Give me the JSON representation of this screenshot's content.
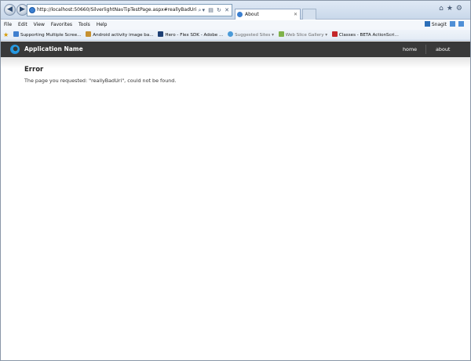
{
  "browser": {
    "address": "http://localhost:50660/SilverlightNavTipTestPage.aspx#reallyBadUri",
    "tab_title": "About",
    "menu": [
      "File",
      "Edit",
      "View",
      "Favorites",
      "Tools",
      "Help"
    ],
    "snagit_label": "Snagit",
    "favorites": [
      "Supporting Multiple Scree...",
      "Android activity image ba...",
      "Hero - Flex SDK - Adobe ...",
      "Suggested Sites",
      "Web Slice Gallery",
      "Classes - BETA ActionScri..."
    ]
  },
  "app": {
    "name": "Application Name",
    "nav": {
      "home": "home",
      "about": "about"
    }
  },
  "error": {
    "title": "Error",
    "message": "The page you requested: \"reallyBadUri\", could not be found."
  },
  "colors": {
    "header_bg": "#393939",
    "logo_accent": "#2aa4e8"
  }
}
